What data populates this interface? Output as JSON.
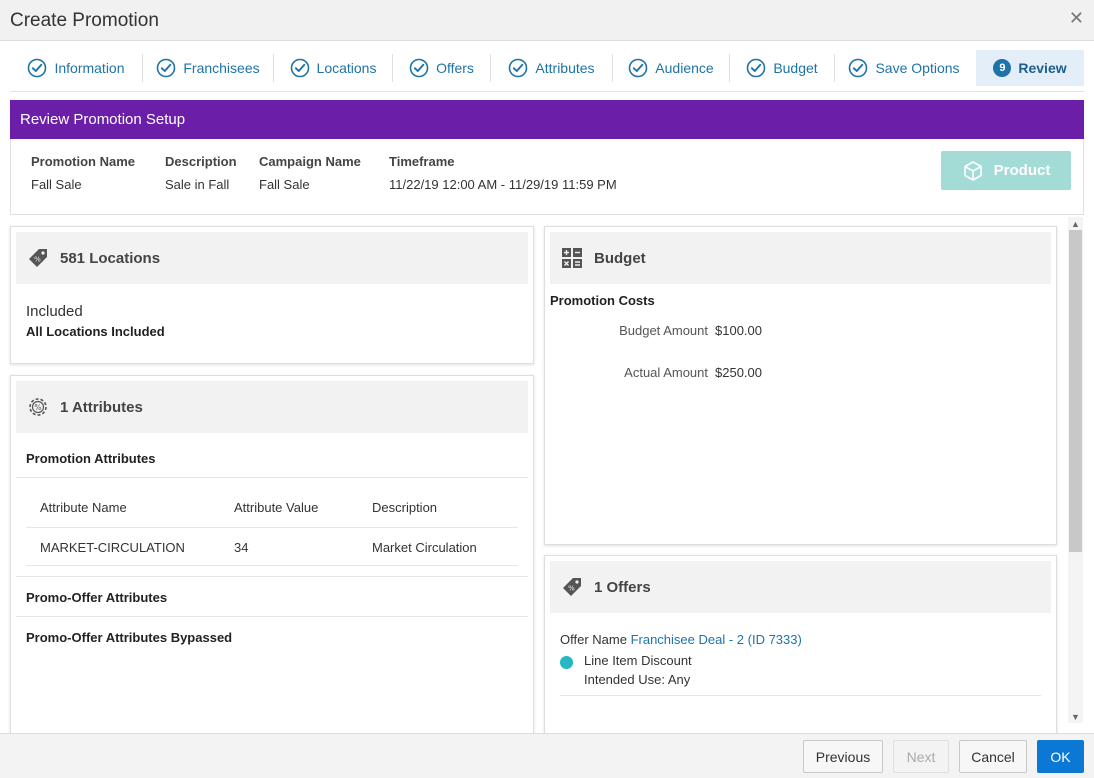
{
  "window": {
    "title": "Create Promotion",
    "close_glyph": "✕"
  },
  "train": {
    "steps": [
      {
        "label": "Information"
      },
      {
        "label": "Franchisees"
      },
      {
        "label": "Locations"
      },
      {
        "label": "Offers"
      },
      {
        "label": "Attributes"
      },
      {
        "label": "Audience"
      },
      {
        "label": "Budget"
      },
      {
        "label": "Save Options"
      },
      {
        "label": "Review",
        "number": "9"
      }
    ]
  },
  "banner": {
    "title": "Review Promotion Setup"
  },
  "summary": {
    "promotion_name_label": "Promotion Name",
    "promotion_name": "Fall Sale",
    "description_label": "Description",
    "description": "Sale in Fall",
    "campaign_name_label": "Campaign Name",
    "campaign_name": "Fall Sale",
    "timeframe_label": "Timeframe",
    "timeframe": "11/22/19 12:00 AM - 11/29/19 11:59 PM",
    "product_button": "Product"
  },
  "locations": {
    "title": "581 Locations",
    "status": "Included",
    "detail": "All Locations Included"
  },
  "attributes": {
    "title": "1 Attributes",
    "promotion_section": "Promotion Attributes",
    "columns": [
      "Attribute Name",
      "Attribute Value",
      "Description"
    ],
    "rows": [
      [
        "MARKET-CIRCULATION",
        "34",
        "Market Circulation"
      ]
    ],
    "promo_offer_section": "Promo-Offer Attributes",
    "promo_offer_note": "Promo-Offer Attributes Bypassed"
  },
  "budget": {
    "title": "Budget",
    "subtitle": "Promotion Costs",
    "budget_amount_label": "Budget Amount",
    "budget_amount": "$100.00",
    "actual_amount_label": "Actual Amount",
    "actual_amount": "$250.00"
  },
  "offers": {
    "title": "1 Offers",
    "offer_name_label": "Offer Name",
    "offer_name": "Franchisee Deal - 2 (ID 7333)",
    "offer_type": "Line Item Discount",
    "intended_use": "Intended Use: Any"
  },
  "footer": {
    "previous": "Previous",
    "next": "Next",
    "cancel": "Cancel",
    "ok": "OK"
  },
  "colors": {
    "accent": "#1e73a8",
    "banner": "#6b1fa8",
    "product_button": "#a3dcd7",
    "offer_dot": "#27b6c4",
    "ok_button": "#0a78d4"
  }
}
